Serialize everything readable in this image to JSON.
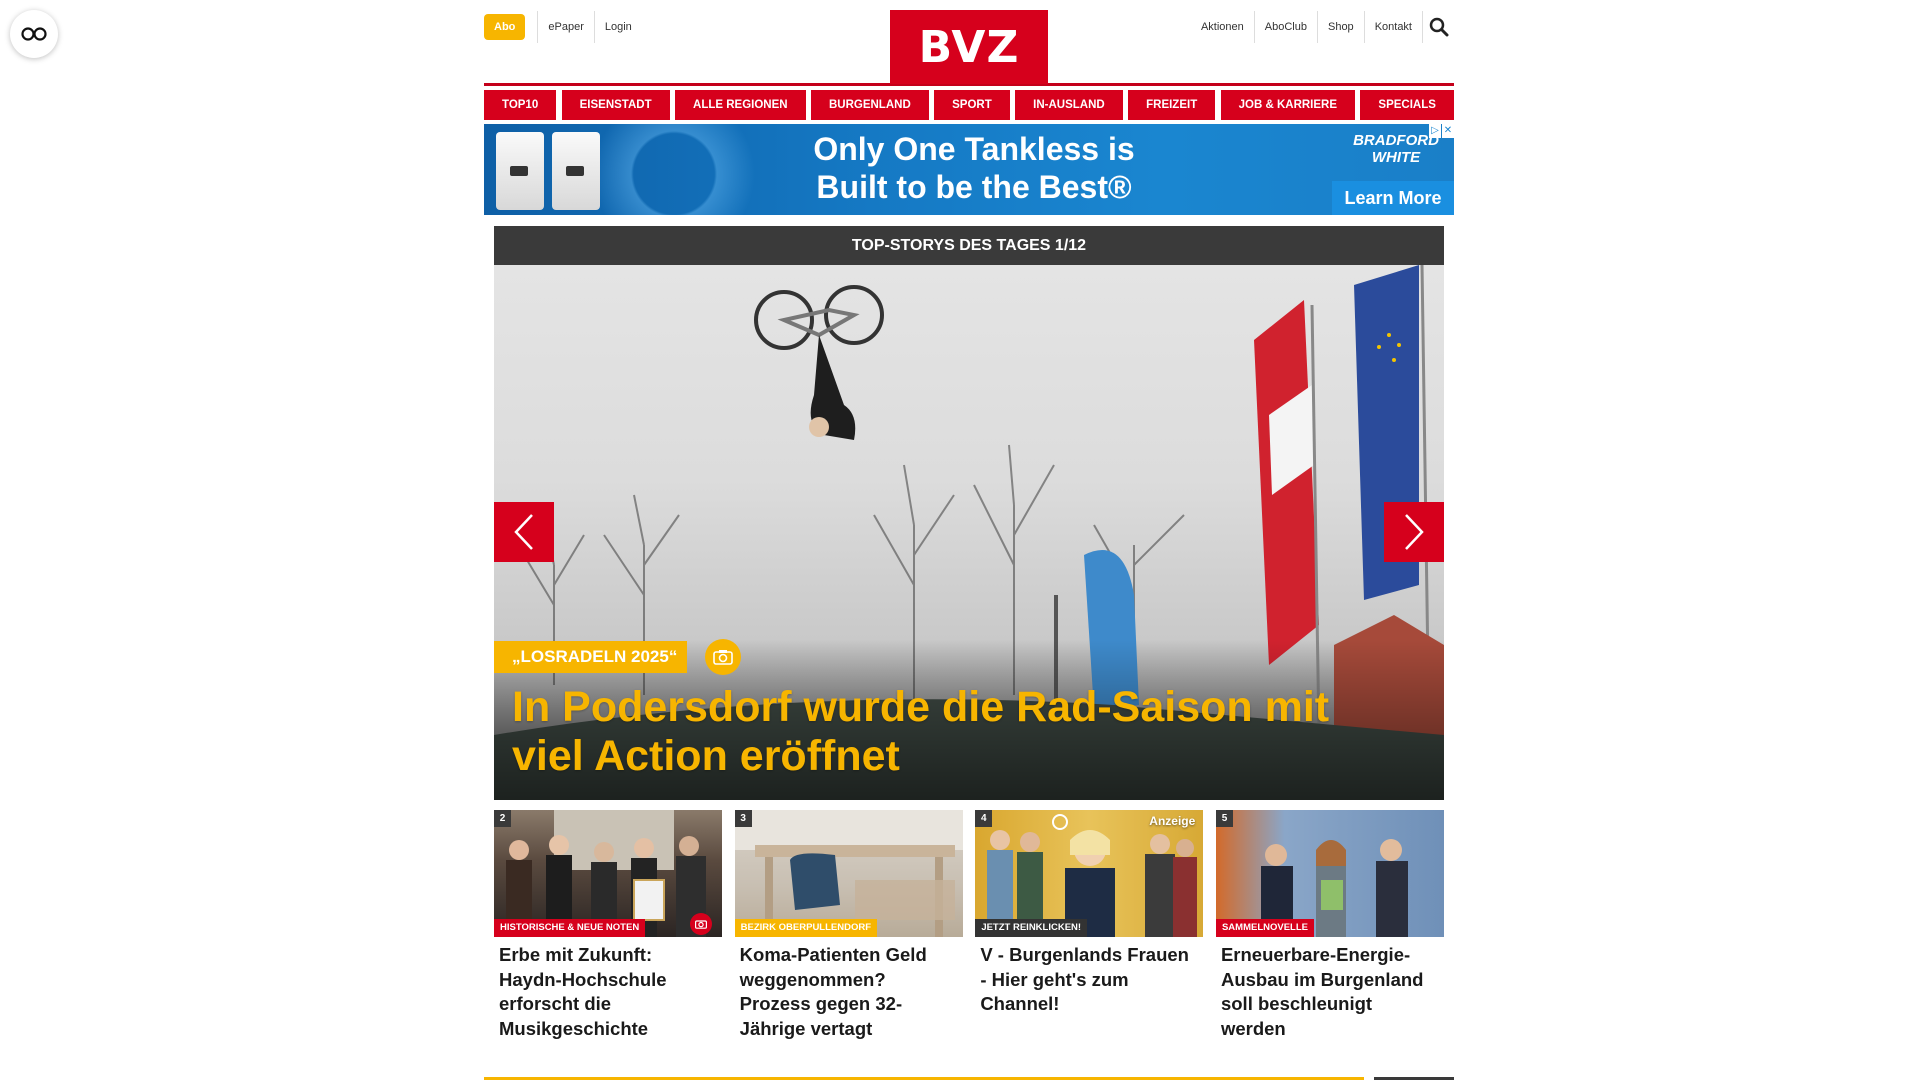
{
  "accessibility": {
    "icon": "glasses-icon"
  },
  "header": {
    "abo_label": "Abo",
    "left_links": [
      "ePaper",
      "Login"
    ],
    "logo_text": "BVZ",
    "right_links": [
      "Aktionen",
      "AboClub",
      "Shop",
      "Kontakt"
    ],
    "search_icon": "search-icon"
  },
  "nav": {
    "items": [
      "TOP10",
      "EISENSTADT",
      "ALLE REGIONEN",
      "BURGENLAND",
      "SPORT",
      "IN-AUSLAND",
      "FREIZEIT",
      "JOB & KARRIERE",
      "SPECIALS"
    ]
  },
  "ad": {
    "headline_line1": "Only One Tankless is",
    "headline_line2": "Built to be the Best®",
    "brand_line1": "BRADFORD",
    "brand_line2": "WHITE",
    "cta": "Learn More",
    "choice_icons": [
      "▷",
      "✕"
    ]
  },
  "top_stories": {
    "header": "TOP-STORYS DES TAGES 1/12",
    "hero": {
      "kicker": "„LOSRADELN 2025“",
      "title": "In Podersdorf wurde die Rad-Saison mit viel Action eröffnet"
    }
  },
  "cards": [
    {
      "num": "2",
      "tag": "HISTORISCHE & NEUE NOTEN",
      "title": "Erbe mit Zukunft: Haydn-Hochschule erforscht die Musikgeschichte"
    },
    {
      "num": "3",
      "tag": "BEZIRK OBERPULLENDORF",
      "title": "Koma-Patienten Geld weggenommen? Prozess gegen 32-Jährige vertagt"
    },
    {
      "num": "4",
      "tag": "JETZT REINKLICKEN!",
      "badge": "Anzeige",
      "title": "V - Burgenlands Frauen - Hier geht's zum Channel!"
    },
    {
      "num": "5",
      "tag": "SAMMELNOVELLE",
      "title": "Erneuerbare-Energie-Ausbau im Burgenland soll beschleunigt werden"
    }
  ],
  "colors": {
    "brand_red": "#d6001c",
    "accent_yellow": "#f7b500",
    "dark_header": "#3a3a3a"
  }
}
